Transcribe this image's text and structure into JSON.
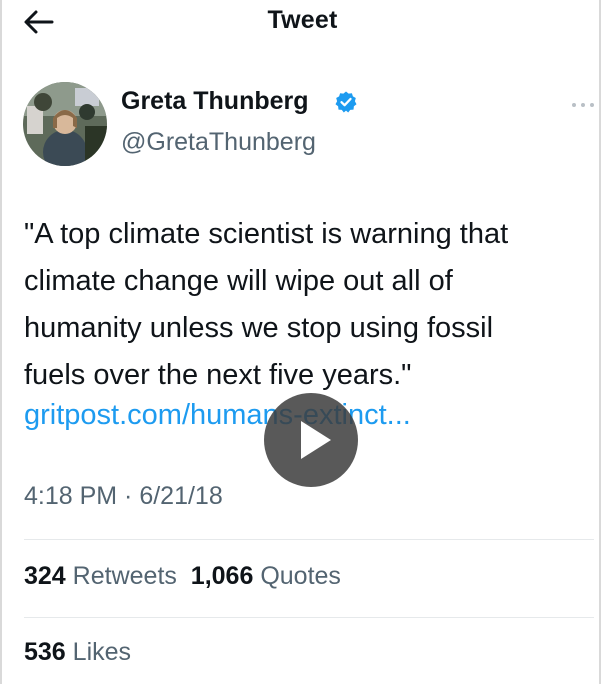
{
  "header": {
    "title": "Tweet",
    "back_icon": "arrow-left-icon"
  },
  "author": {
    "display_name": "Greta Thunberg",
    "handle": "@GretaThunberg",
    "verified_icon": "verified-badge-icon",
    "more_icon": "more-dots-icon"
  },
  "tweet": {
    "text_lines": [
      "\"A top climate scientist is warning that",
      "climate change will wipe out all of",
      "humanity unless we stop using fossil",
      "fuels over the next five years.\""
    ],
    "link": "gritpost.com/humans-extinct...",
    "play_icon": "play-icon",
    "timestamp": "4:18 PM · 6/21/18"
  },
  "stats": {
    "retweets_count": "324",
    "retweets_label": "Retweets",
    "quotes_count": "1,066",
    "quotes_label": "Quotes",
    "likes_count": "536",
    "likes_label": "Likes"
  },
  "colors": {
    "link": "#1d9bf0",
    "verified": "#1d9bf0",
    "secondary_text": "#536471",
    "primary_text": "#0f1419"
  }
}
